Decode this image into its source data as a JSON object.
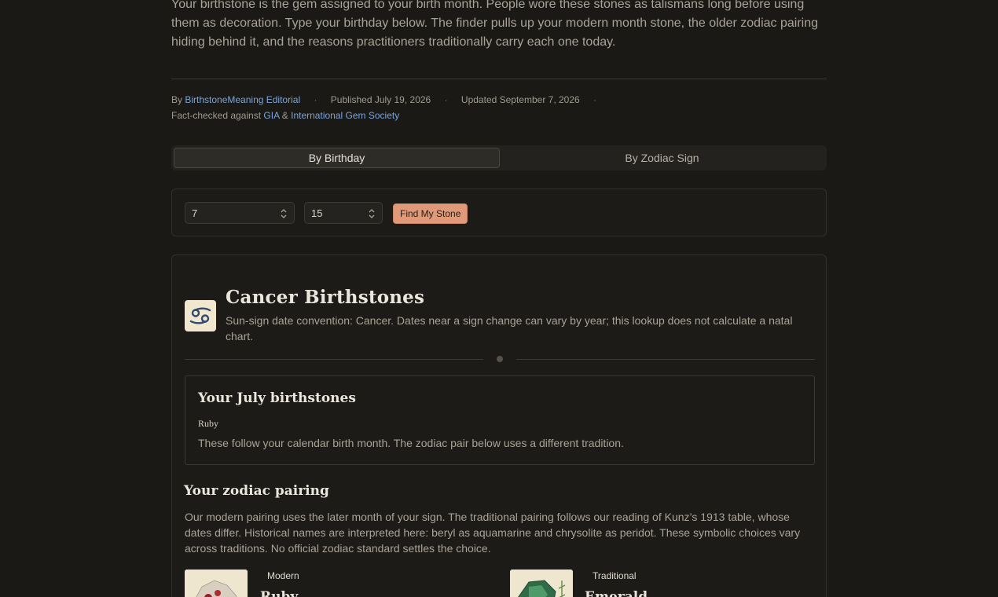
{
  "intro": {
    "text": "Your birthstone is the gem assigned to your birth month. People wore these stones as talismans long before using them as decoration. Type your birthday below. The finder pulls up your modern month stone, the older zodiac pairing hiding behind it, and the reasons practitioners traditionally carry each one today."
  },
  "byline": {
    "by_prefix": "By",
    "author": "BirthstoneMeaning Editorial",
    "dot": "·",
    "published": "Published July 19, 2026",
    "updated": "Updated September 7, 2026",
    "factcheck_prefix": "Fact-checked against",
    "source1": "GIA",
    "amp": "&",
    "source2": "International Gem Society"
  },
  "tabs": [
    {
      "label": "By Birthday",
      "active": true
    },
    {
      "label": "By Zodiac Sign",
      "active": false
    }
  ],
  "form": {
    "month_value": "7",
    "day_value": "15",
    "submit_label": "Find My Stone"
  },
  "result": {
    "sign_icon": "cancer-zodiac-icon",
    "sign_glyph": "♋",
    "title": "Cancer Birthstones",
    "description": "Sun-sign date convention: Cancer. Dates near a sign change can vary by year; this lookup does not calculate a natal chart.",
    "month": {
      "title": "Your July birthstones",
      "stone": "Ruby",
      "note": "These follow your calendar birth month. The zodiac pair below uses a different tradition."
    },
    "pairing": {
      "title": "Your zodiac pairing",
      "description": "Our modern pairing uses the later month of your sign. The traditional pairing follows our reading of Kunz’s 1913 table, whose dates differ. Historical names are interpreted here: beryl as aquamarine and chrysolite as peridot. These symbolic choices vary across traditions. No official zodiac standard settles the choice.",
      "modern": {
        "label": "Modern",
        "stone": "Ruby"
      },
      "traditional": {
        "label": "Traditional",
        "stone": "Emerald"
      }
    }
  },
  "colors": {
    "background": "#1a1916",
    "accent": "#e09a79",
    "link": "#7aa4d8"
  }
}
